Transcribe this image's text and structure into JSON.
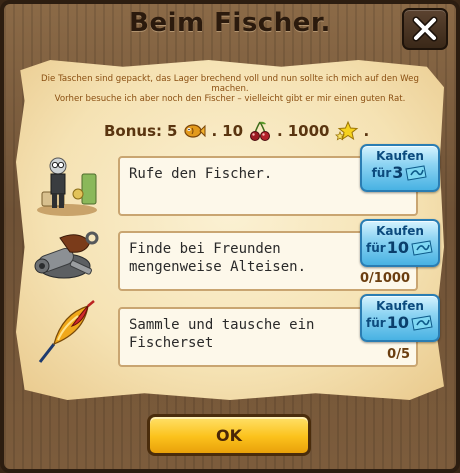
{
  "dialog": {
    "title": "Beim Fischer.",
    "intro_line1": "Die Taschen sind gepackt, das Lager brechend voll und nun sollte ich mich auf den Weg machen.",
    "intro_line2": "Vorher besuche ich aber noch den Fischer – vielleicht gibt er mir einen guten Rat."
  },
  "bonus": {
    "label": "Bonus:",
    "items": [
      {
        "amount": "5",
        "icon": "golden-fish-icon",
        "sep": "."
      },
      {
        "amount": "10",
        "icon": "cherries-icon",
        "sep": "."
      },
      {
        "amount": "1000",
        "icon": "experience-stars-icon",
        "sep": "."
      }
    ]
  },
  "tasks": [
    {
      "icon": "fisherman-figure-icon",
      "text": "Rufe den Fischer.",
      "progress": "",
      "buy_label": "Kaufen",
      "buy_prefix": "für",
      "buy_cost": "3",
      "cost_icon": "blue-ticket-icon"
    },
    {
      "icon": "scrap-iron-icon",
      "text": "Finde bei Freunden mengenweise Alteisen.",
      "progress": "0/1000",
      "buy_label": "Kaufen",
      "buy_prefix": "für",
      "buy_cost": "10",
      "cost_icon": "blue-ticket-icon"
    },
    {
      "icon": "fishing-float-icon",
      "text": "Sammle und tausche ein Fischerset",
      "progress": "0/5",
      "buy_label": "Kaufen",
      "buy_prefix": "für",
      "buy_cost": "10",
      "cost_icon": "blue-ticket-icon"
    }
  ],
  "footer": {
    "ok_label": "OK"
  },
  "colors": {
    "accent_buy": "#48b2e3",
    "ok_button": "#fbc21c",
    "parchment": "#f5e2b3",
    "frame_wood": "#6f5236"
  }
}
